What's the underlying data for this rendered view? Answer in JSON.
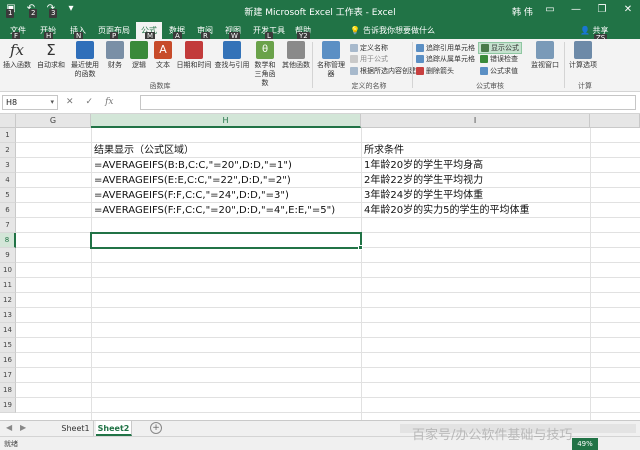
{
  "window": {
    "title": "新建 Microsoft Excel 工作表 - Excel",
    "user": "韩 伟",
    "minimize_label": "—",
    "restore_label": "❐",
    "close_label": "✕"
  },
  "qat": {
    "save_key": "1",
    "undo_key": "2",
    "redo_key": "3"
  },
  "tabs": [
    {
      "label": "文件",
      "key": "F"
    },
    {
      "label": "开始",
      "key": "H"
    },
    {
      "label": "插入",
      "key": "N"
    },
    {
      "label": "页面布局",
      "key": "P"
    },
    {
      "label": "公式",
      "key": "M"
    },
    {
      "label": "数据",
      "key": "A"
    },
    {
      "label": "审阅",
      "key": "R"
    },
    {
      "label": "视图",
      "key": "W"
    },
    {
      "label": "开发工具",
      "key": "L"
    },
    {
      "label": "帮助",
      "key": "Y2"
    }
  ],
  "tell_me": "告诉我你想要做什么",
  "share": "共享",
  "share_key": "ZS",
  "ribbon": {
    "insert_function": "插入函数",
    "autosum": "自动求和",
    "recent": "最近使用的函数",
    "financial": "财务",
    "logical": "逻辑",
    "text": "文本",
    "datetime": "日期和时间",
    "lookup": "查找与引用",
    "math": "数学和三角函数",
    "other": "其他函数",
    "group_library": "函数库",
    "name_manager": "名称管理器",
    "define_name": "定义名称",
    "use_in_formula": "用于公式",
    "create_from_sel": "根据所选内容创建",
    "group_names": "定义的名称",
    "trace_precedents": "追踪引用单元格",
    "trace_dependents": "追踪从属单元格",
    "remove_arrows": "删除箭头",
    "show_formulas": "显示公式",
    "error_checking": "错误检查",
    "evaluate_formula": "公式求值",
    "watch_window": "监视窗口",
    "group_audit": "公式审核",
    "calc_options": "计算选项",
    "group_calc": "计算"
  },
  "formula_bar": {
    "name_box": "H8",
    "cancel": "✕",
    "enter": "✓",
    "fx": "fx",
    "value": ""
  },
  "grid": {
    "columns": [
      "G",
      "H",
      "I"
    ],
    "rows": [
      "1",
      "2",
      "3",
      "4",
      "5",
      "6",
      "7",
      "8",
      "9",
      "10",
      "11",
      "12",
      "13",
      "14",
      "15",
      "16",
      "17",
      "18",
      "19"
    ],
    "cells": {
      "H2": "结果显示（公式区域）",
      "I2": "所求条件",
      "H3": "=AVERAGEIFS(B:B,C:C,\"=20\",D:D,\"=1\")",
      "I3": "1年龄20岁的学生平均身高",
      "H4": "=AVERAGEIFS(E:E,C:C,\"=22\",D:D,\"=2\")",
      "I4": "2年龄22岁的学生平均视力",
      "H5": "=AVERAGEIFS(F:F,C:C,\"=24\",D:D,\"=3\")",
      "I5": "3年龄24岁的学生平均体重",
      "H6": "=AVERAGEIFS(F:F,C:C,\"=20\",D:D,\"=4\",E:E,\"=5\")",
      "I6": "4年龄20岁的实力5的学生的平均体重"
    }
  },
  "sheets": [
    "Sheet1",
    "Sheet2"
  ],
  "active_sheet": "Sheet2",
  "status": "就绪",
  "zoom": "49%",
  "watermark": "百家号/办公软件基础与技巧"
}
